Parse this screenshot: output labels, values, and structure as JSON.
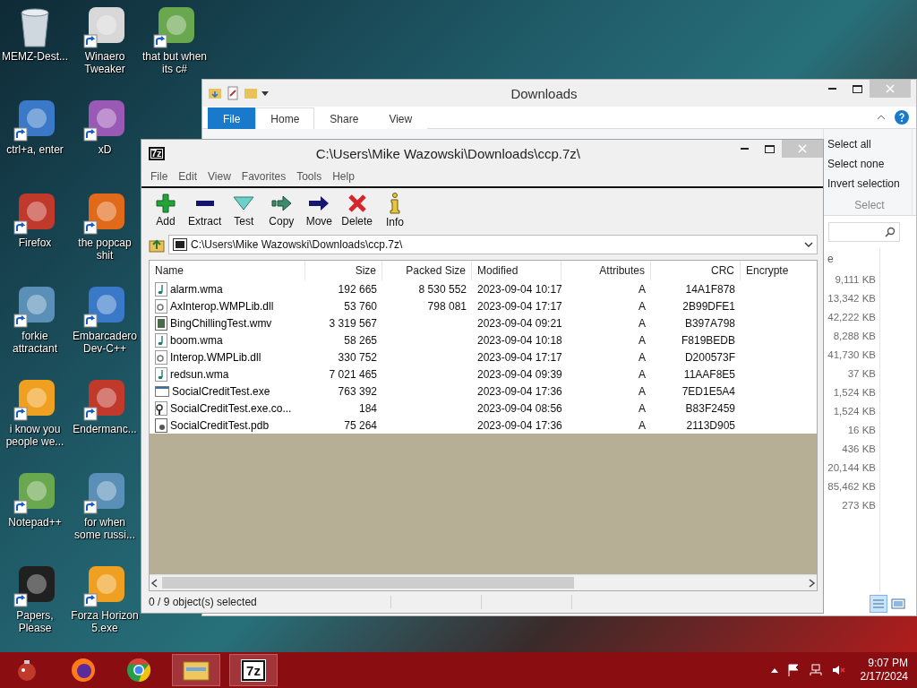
{
  "desktop_icons": [
    {
      "label": "MEMZ-Dest...",
      "kind": "recycle-bin"
    },
    {
      "label": "ctrl+a, enter",
      "kind": "shortcut"
    },
    {
      "label": "Firefox",
      "kind": "shortcut"
    },
    {
      "label": "forkie attractant",
      "kind": "shortcut"
    },
    {
      "label": "i know you people we...",
      "kind": "shortcut"
    },
    {
      "label": "Notepad++",
      "kind": "shortcut"
    },
    {
      "label": "Papers, Please",
      "kind": "shortcut"
    },
    {
      "label": "Winaero Tweaker",
      "kind": "shortcut"
    },
    {
      "label": "xD",
      "kind": "shortcut"
    },
    {
      "label": "the popcap shit",
      "kind": "shortcut"
    },
    {
      "label": "Embarcadero Dev-C++",
      "kind": "shortcut"
    },
    {
      "label": "Endermanc...",
      "kind": "shortcut"
    },
    {
      "label": "for when some russi...",
      "kind": "shortcut"
    },
    {
      "label": "Forza Horizon 5.exe",
      "kind": "shortcut"
    },
    {
      "label": "that but when its c#",
      "kind": "shortcut"
    }
  ],
  "explorer": {
    "title": "Downloads",
    "ribbon_tabs": [
      {
        "label": "File",
        "kind": "file",
        "selected": false
      },
      {
        "label": "Home",
        "kind": "tab",
        "selected": true
      },
      {
        "label": "Share",
        "kind": "tab",
        "selected": false
      },
      {
        "label": "View",
        "kind": "tab",
        "selected": false
      }
    ],
    "select_group": {
      "items": [
        "Select all",
        "Select none",
        "Invert selection"
      ],
      "label": "Select"
    },
    "column_header": "e",
    "sizes": [
      "9,111 KB",
      "13,342 KB",
      "42,222 KB",
      "8,288 KB",
      "41,730 KB",
      "37 KB",
      "1,524 KB",
      "1,524 KB",
      "16 KB",
      "436 KB",
      "20,144 KB",
      "85,462 KB",
      "273 KB"
    ]
  },
  "sevenzip": {
    "logo": "7z",
    "title": "C:\\Users\\Mike Wazowski\\Downloads\\ccp.7z\\",
    "menu": [
      "File",
      "Edit",
      "View",
      "Favorites",
      "Tools",
      "Help"
    ],
    "toolbar": [
      {
        "label": "Add",
        "kind": "add"
      },
      {
        "label": "Extract",
        "kind": "extract"
      },
      {
        "label": "Test",
        "kind": "test"
      },
      {
        "label": "Copy",
        "kind": "copy"
      },
      {
        "label": "Move",
        "kind": "move"
      },
      {
        "label": "Delete",
        "kind": "delete"
      },
      {
        "label": "Info",
        "kind": "info"
      }
    ],
    "address": "C:\\Users\\Mike Wazowski\\Downloads\\ccp.7z\\",
    "columns": [
      "Name",
      "Size",
      "Packed Size",
      "Modified",
      "Attributes",
      "CRC",
      "Encrypte"
    ],
    "rows": [
      {
        "kind": "audio",
        "name": "alarm.wma",
        "size": "192 665",
        "packed_size": "8 530 552",
        "modified": "2023-09-04 10:17",
        "attributes": "A",
        "crc": "14A1F878"
      },
      {
        "kind": "library",
        "name": "AxInterop.WMPLib.dll",
        "size": "53 760",
        "packed_size": "798 081",
        "modified": "2023-09-04 17:17",
        "attributes": "A",
        "crc": "2B99DFE1"
      },
      {
        "kind": "video",
        "name": "BingChillingTest.wmv",
        "size": "3 319 567",
        "modified": "2023-09-04 09:21",
        "attributes": "A",
        "crc": "B397A798"
      },
      {
        "kind": "audio",
        "name": "boom.wma",
        "size": "58 265",
        "modified": "2023-09-04 10:18",
        "attributes": "A",
        "crc": "F819BEDB"
      },
      {
        "kind": "library",
        "name": "Interop.WMPLib.dll",
        "size": "330 752",
        "modified": "2023-09-04 17:17",
        "attributes": "A",
        "crc": "D200573F"
      },
      {
        "kind": "audio",
        "name": "redsun.wma",
        "size": "7 021 465",
        "modified": "2023-09-04 09:39",
        "attributes": "A",
        "crc": "11AAF8E5"
      },
      {
        "kind": "program",
        "name": "SocialCreditTest.exe",
        "size": "763 392",
        "modified": "2023-09-04 17:36",
        "attributes": "A",
        "crc": "7ED1E5A4"
      },
      {
        "kind": "config",
        "name": "SocialCreditTest.exe.co...",
        "size": "184",
        "modified": "2023-09-04 08:56",
        "attributes": "A",
        "crc": "B83F2459"
      },
      {
        "kind": "debug",
        "name": "SocialCreditTest.pdb",
        "size": "75 264",
        "modified": "2023-09-04 17:36",
        "attributes": "A",
        "crc": "2113D905"
      }
    ],
    "status": "0 / 9 object(s) selected"
  },
  "taskbar": {
    "apps": [
      {
        "kind": "start",
        "open": false
      },
      {
        "kind": "firefox",
        "open": false
      },
      {
        "kind": "chrome",
        "open": false
      },
      {
        "kind": "explorer",
        "open": true
      },
      {
        "kind": "sevenzip",
        "label": "7z",
        "open": true
      }
    ],
    "clock": {
      "time": "9:07 PM",
      "date": "2/17/2024"
    }
  }
}
